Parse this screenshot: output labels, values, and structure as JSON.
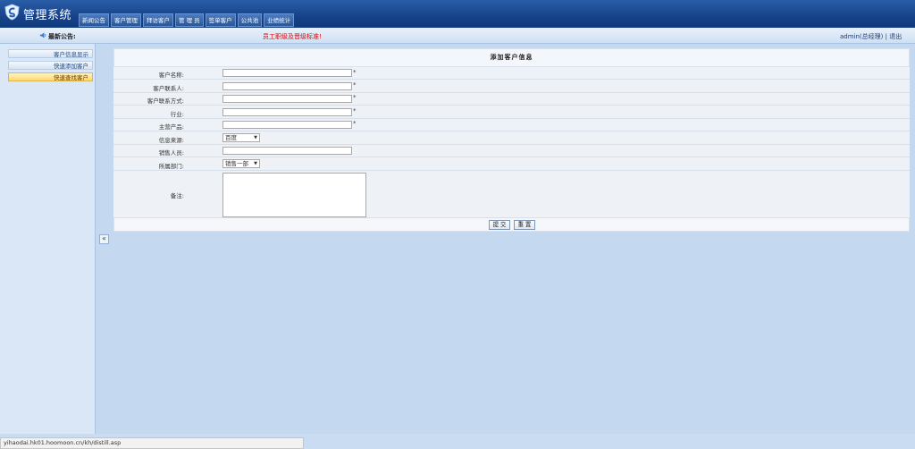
{
  "app": {
    "title": "管理系统",
    "logo_icon": "shield-logo-icon"
  },
  "nav": {
    "items": [
      {
        "label": "新闻公告"
      },
      {
        "label": "客户管理"
      },
      {
        "label": "拜访客户"
      },
      {
        "label": "管 理 员"
      },
      {
        "label": "签单客户"
      },
      {
        "label": "公共池"
      },
      {
        "label": "业绩统计"
      }
    ]
  },
  "notice": {
    "icon": "speaker-icon",
    "label": "最新公告:",
    "text": "员工职级及晋级标准!"
  },
  "user": {
    "name": "admin(总经理)",
    "separator": " | ",
    "logout": "退出"
  },
  "sidebar": {
    "items": [
      {
        "label": "客户信息显示"
      },
      {
        "label": "快速添加客户"
      },
      {
        "label": "快速查找客户"
      }
    ],
    "active_index": 2,
    "collapse_label": "«"
  },
  "form": {
    "title": "添加客户信息",
    "fields": {
      "customer_name": {
        "label": "客户名称:",
        "value": "",
        "required_mark": "*"
      },
      "contact_person": {
        "label": "客户联系人:",
        "value": "",
        "required_mark": "*"
      },
      "contact_info": {
        "label": "客户联系方式:",
        "value": "",
        "required_mark": "*"
      },
      "industry": {
        "label": "行业:",
        "value": "",
        "required_mark": "*"
      },
      "main_product": {
        "label": "主营产品:",
        "value": "",
        "required_mark": "*"
      },
      "info_source": {
        "label": "信息来源:",
        "selected": "百度"
      },
      "sales_person": {
        "label": "销售人员:",
        "value": ""
      },
      "department": {
        "label": "所属部门:",
        "selected": "销售一部"
      },
      "remarks": {
        "label": "备注:",
        "value": ""
      }
    },
    "submit_label": "提 交",
    "reset_label": "重 置"
  },
  "status_bar": {
    "url": "yihaodai.hk01.hoomoon.cn/kh/distill.asp"
  },
  "colors": {
    "header": "#16428a",
    "notice_text": "#e00000",
    "active_sidebar": "#ffd86b",
    "page_bg": "#c4d8ef"
  }
}
